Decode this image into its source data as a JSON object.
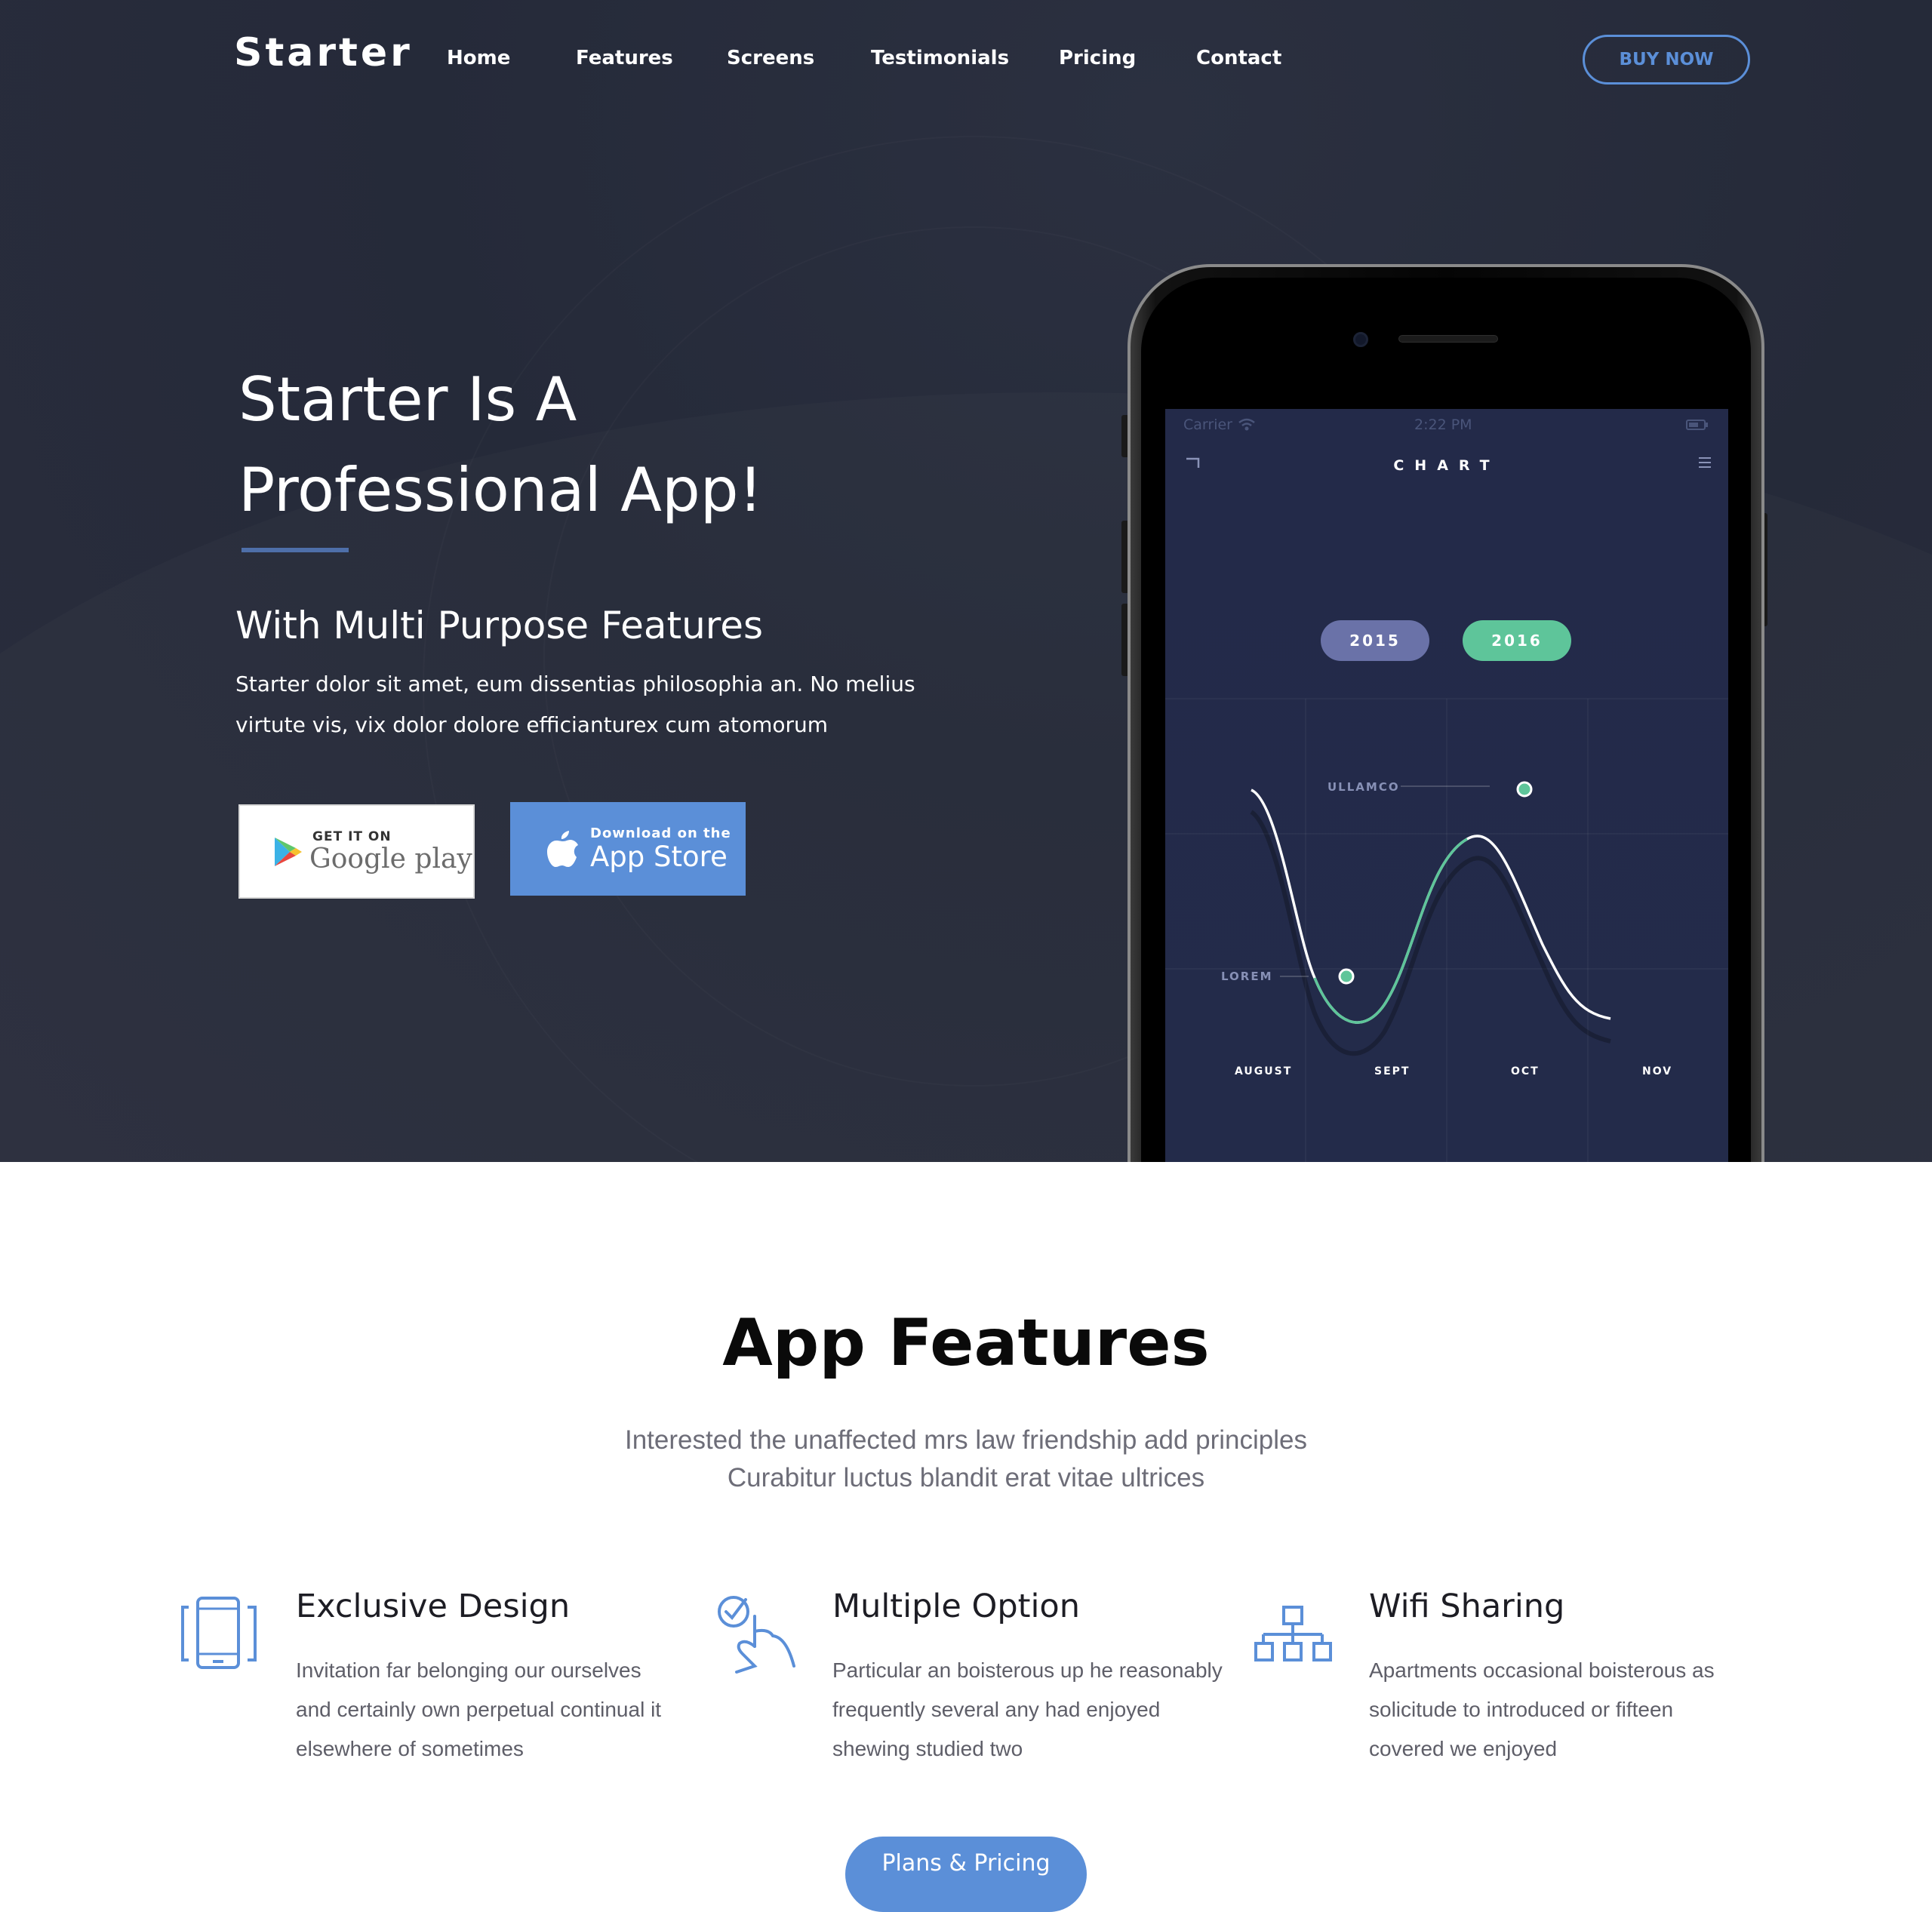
{
  "nav": {
    "logo": "Starter",
    "links": [
      "Home",
      "Features",
      "Screens",
      "Testimonials",
      "Pricing",
      "Contact"
    ],
    "buy_now": "BUY NOW"
  },
  "hero": {
    "title_line1": "Starter Is A",
    "title_line2": "Professional App!",
    "subtitle": "With Multi Purpose Features",
    "text_line1": "Starter dolor sit amet, eum dissentias philosophia an. No melius",
    "text_line2": "virtute vis, vix dolor dolore efficianturex cum atomorum",
    "google_play": {
      "small": "GET IT ON",
      "big": "Google play"
    },
    "app_store": {
      "small": "Download on the",
      "big": "App Store"
    }
  },
  "phone": {
    "status_carrier": "Carrier",
    "status_time": "2:22 PM",
    "screen_title": "CHART",
    "pills": [
      "2015",
      "2016"
    ],
    "labels": [
      "ULLAMCO",
      "LOREM"
    ],
    "months": [
      "AUGUST",
      "SEPT",
      "OCT",
      "NOV"
    ]
  },
  "features": {
    "title": "App Features",
    "subtitle_line1": "Interested the unaffected mrs law friendship add principles",
    "subtitle_line2": "Curabitur luctus blandit erat vitae ultrices",
    "items": [
      {
        "title": "Exclusive Design",
        "lines": [
          "Invitation far belonging our ourselves",
          "and certainly own perpetual continual it",
          "elsewhere of sometimes"
        ],
        "icon": "tablet-icon"
      },
      {
        "title": "Multiple Option",
        "lines": [
          "Particular an boisterous up he reasonably",
          "frequently several any had enjoyed",
          "shewing studied two"
        ],
        "icon": "touch-check-icon"
      },
      {
        "title": "Wifi Sharing",
        "lines": [
          "Apartments occasional boisterous as",
          "solicitude to introduced or fifteen",
          "covered we enjoyed"
        ],
        "icon": "network-icon"
      }
    ],
    "plans_button": "Plans & Pricing"
  },
  "colors": {
    "hero_bg": "#262b3a",
    "accent_blue": "#5b8fd8",
    "pill_2015": "#6a72a8",
    "pill_2016": "#5ec59a",
    "screen_bg": "#232a49"
  }
}
